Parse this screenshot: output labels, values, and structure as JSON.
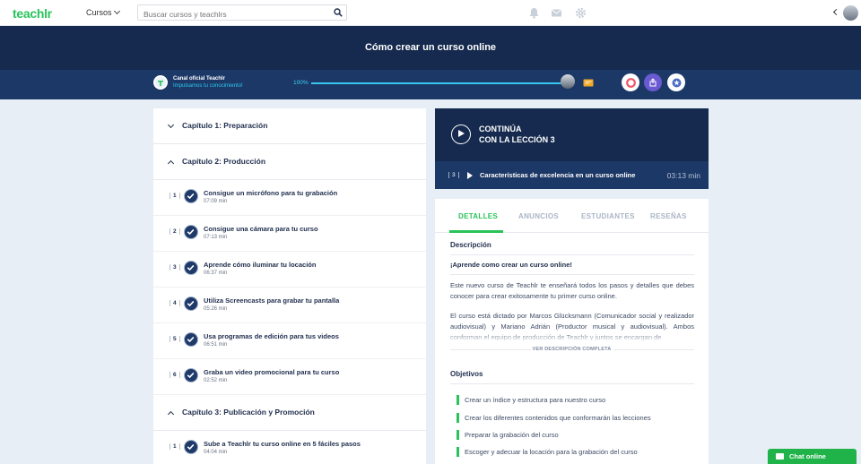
{
  "header": {
    "logo": "teachlr",
    "nav_cursos": "Cursos",
    "search_placeholder": "Buscar cursos y teachlrs"
  },
  "course": {
    "title": "Cómo crear un curso online",
    "channel_name": "Canal oficial Teachlr",
    "channel_tagline": "Impulsamos tu conocimiento!",
    "progress_label": "100%",
    "progress_value": 1.0
  },
  "chapters": [
    {
      "title": "Capítulo 1: Preparación",
      "expanded": false,
      "lessons": []
    },
    {
      "title": "Capítulo 2: Producción",
      "expanded": true,
      "lessons": [
        {
          "num": "1",
          "title": "Consigue un micrófono para tu grabación",
          "duration": "07:09 min"
        },
        {
          "num": "2",
          "title": "Consigue una cámara para tu curso",
          "duration": "07:13 min"
        },
        {
          "num": "3",
          "title": "Aprende cómo iluminar tu locación",
          "duration": "06:37 min"
        },
        {
          "num": "4",
          "title": "Utiliza Screencasts para grabar tu pantalla",
          "duration": "05:26 min"
        },
        {
          "num": "5",
          "title": "Usa programas de edición para tus videos",
          "duration": "06:51 min"
        },
        {
          "num": "6",
          "title": "Graba un video promocional para tu curso",
          "duration": "02:52 min"
        }
      ]
    },
    {
      "title": "Capítulo 3: Publicación y Promoción",
      "expanded": true,
      "lessons": [
        {
          "num": "1",
          "title": "Sube a Teachlr tu curso online en 5 fáciles pasos",
          "duration": "04:04 min"
        }
      ]
    }
  ],
  "continue": {
    "line1": "CONTINÚA",
    "line2": "CON LA LECCIÓN 3",
    "lesson_num": "3",
    "lesson_title": "Características de excelencia en un curso online",
    "duration": "03:13 min"
  },
  "tabs": [
    "DETALLES",
    "ANUNCIOS",
    "ESTUDIANTES",
    "RESEÑAS"
  ],
  "details": {
    "description_heading": "Descripción",
    "lead": "¡Aprende como crear un curso online!",
    "para1": "Este nuevo curso de Teachlr te enseñará todos los pasos y detalles que debes conocer para crear exitosamente tu primer curso online.",
    "para2": "El curso está dictado por Marcos Glücksmann (Comunicador social y realizador audiovisual) y Mariano Adrián (Productor musical y audiovisual). Ambos conforman el equipo de producción de Teachlr y juntos se encargan de",
    "ver_mas": "VER DESCRIPCIÓN COMPLETA",
    "objectives_heading": "Objetivos",
    "objectives": [
      "Crear un índice y estructura para nuestro curso",
      "Crear los diferentes contenidos que conformarán las lecciones",
      "Preparar la grabación del curso",
      "Escoger y adecuar la locación para la grabación del curso"
    ]
  },
  "chat": {
    "label": "Chat online"
  },
  "colors": {
    "brand_green": "#29c35a",
    "navy": "#152a4e",
    "navy_light": "#1c3866",
    "progress": "#37c7ef"
  }
}
